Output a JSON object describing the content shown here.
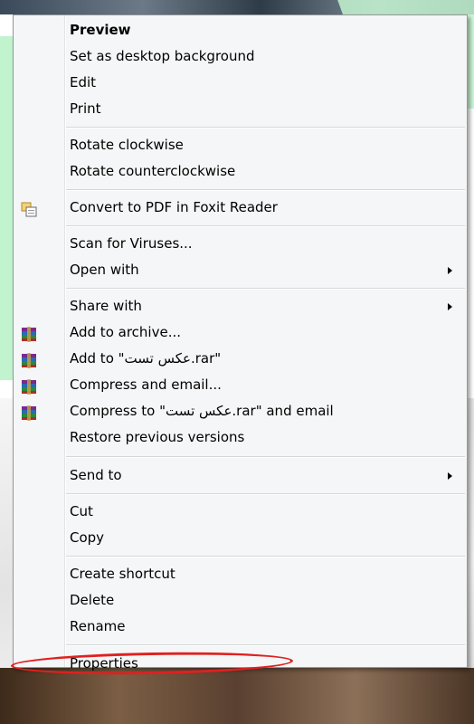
{
  "menu": {
    "items": [
      {
        "label": "Preview"
      },
      {
        "label": "Set as desktop background"
      },
      {
        "label": "Edit"
      },
      {
        "label": "Print"
      },
      {
        "label": "Rotate clockwise"
      },
      {
        "label": "Rotate counterclockwise"
      },
      {
        "label": "Convert to PDF in Foxit Reader",
        "icon": "foxit-pdf-icon"
      },
      {
        "label": "Scan for Viruses..."
      },
      {
        "label": "Open with",
        "submenu": true
      },
      {
        "label": "Share with",
        "submenu": true
      },
      {
        "label": "Add to archive...",
        "icon": "winrar-icon"
      },
      {
        "label": "Add to \"عکس تست.rar\"",
        "icon": "winrar-icon"
      },
      {
        "label": "Compress and email...",
        "icon": "winrar-icon"
      },
      {
        "label": "Compress to \"عکس تست.rar\" and email",
        "icon": "winrar-icon"
      },
      {
        "label": "Restore previous versions"
      },
      {
        "label": "Send to",
        "submenu": true
      },
      {
        "label": "Cut"
      },
      {
        "label": "Copy"
      },
      {
        "label": "Create shortcut"
      },
      {
        "label": "Delete"
      },
      {
        "label": "Rename"
      },
      {
        "label": "Properties"
      }
    ]
  },
  "colors": {
    "menu_background": "#f5f6f7",
    "highlight_ellipse": "#e02020"
  }
}
